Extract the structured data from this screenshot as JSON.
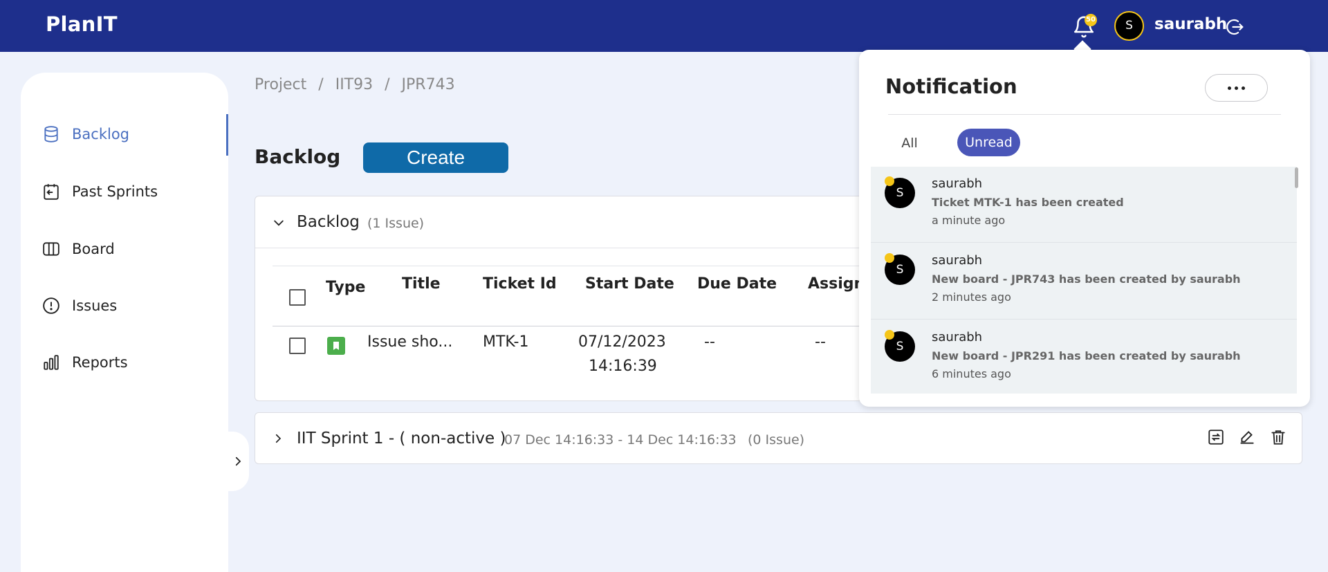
{
  "app": {
    "brand": "PlanIT"
  },
  "header": {
    "notification_count": "50",
    "user_initial": "S",
    "username": "saurabh"
  },
  "sidebar": {
    "items": [
      {
        "label": "Backlog",
        "icon": "database-icon",
        "active": true
      },
      {
        "label": "Past Sprints",
        "icon": "calendar-icon",
        "active": false
      },
      {
        "label": "Board",
        "icon": "columns-icon",
        "active": false
      },
      {
        "label": "Issues",
        "icon": "alert-circle-icon",
        "active": false
      },
      {
        "label": "Reports",
        "icon": "bar-chart-icon",
        "active": false
      }
    ]
  },
  "breadcrumb": [
    "Project",
    "/",
    "IIT93",
    "/",
    "JPR743"
  ],
  "page": {
    "title": "Backlog",
    "create_label": "Create"
  },
  "backlog": {
    "title": "Backlog",
    "count": "(1 Issue)",
    "columns": [
      "Type",
      "Title",
      "Ticket Id",
      "Start Date",
      "Due Date",
      "Assigne"
    ],
    "rows": [
      {
        "title": "Issue sho...",
        "ticket_id": "MTK-1",
        "start_date": "07/12/2023",
        "start_time": "14:16:39",
        "due_date": "--",
        "assignee": "--"
      }
    ]
  },
  "sprint": {
    "title": "IIT Sprint 1 - ( non-active )",
    "dates": "07 Dec 14:16:33 - 14 Dec 14:16:33",
    "count": "(0 Issue)"
  },
  "notifications": {
    "title": "Notification",
    "tabs": {
      "all": "All",
      "unread": "Unread"
    },
    "items": [
      {
        "initial": "S",
        "user": "saurabh",
        "message": "Ticket MTK-1 has been created",
        "time": "a minute ago"
      },
      {
        "initial": "S",
        "user": "saurabh",
        "message": "New board - JPR743 has been created by saurabh",
        "time": "2 minutes ago"
      },
      {
        "initial": "S",
        "user": "saurabh",
        "message": "New board - JPR291 has been created by saurabh",
        "time": "6 minutes ago"
      }
    ]
  },
  "colors": {
    "topbar": "#1e2f8c",
    "accent": "#4a6fc0",
    "create_button": "#0f6aa8",
    "unread_tab": "#4a56b8",
    "badge": "#f5c518",
    "story_icon": "#4cae4c"
  }
}
